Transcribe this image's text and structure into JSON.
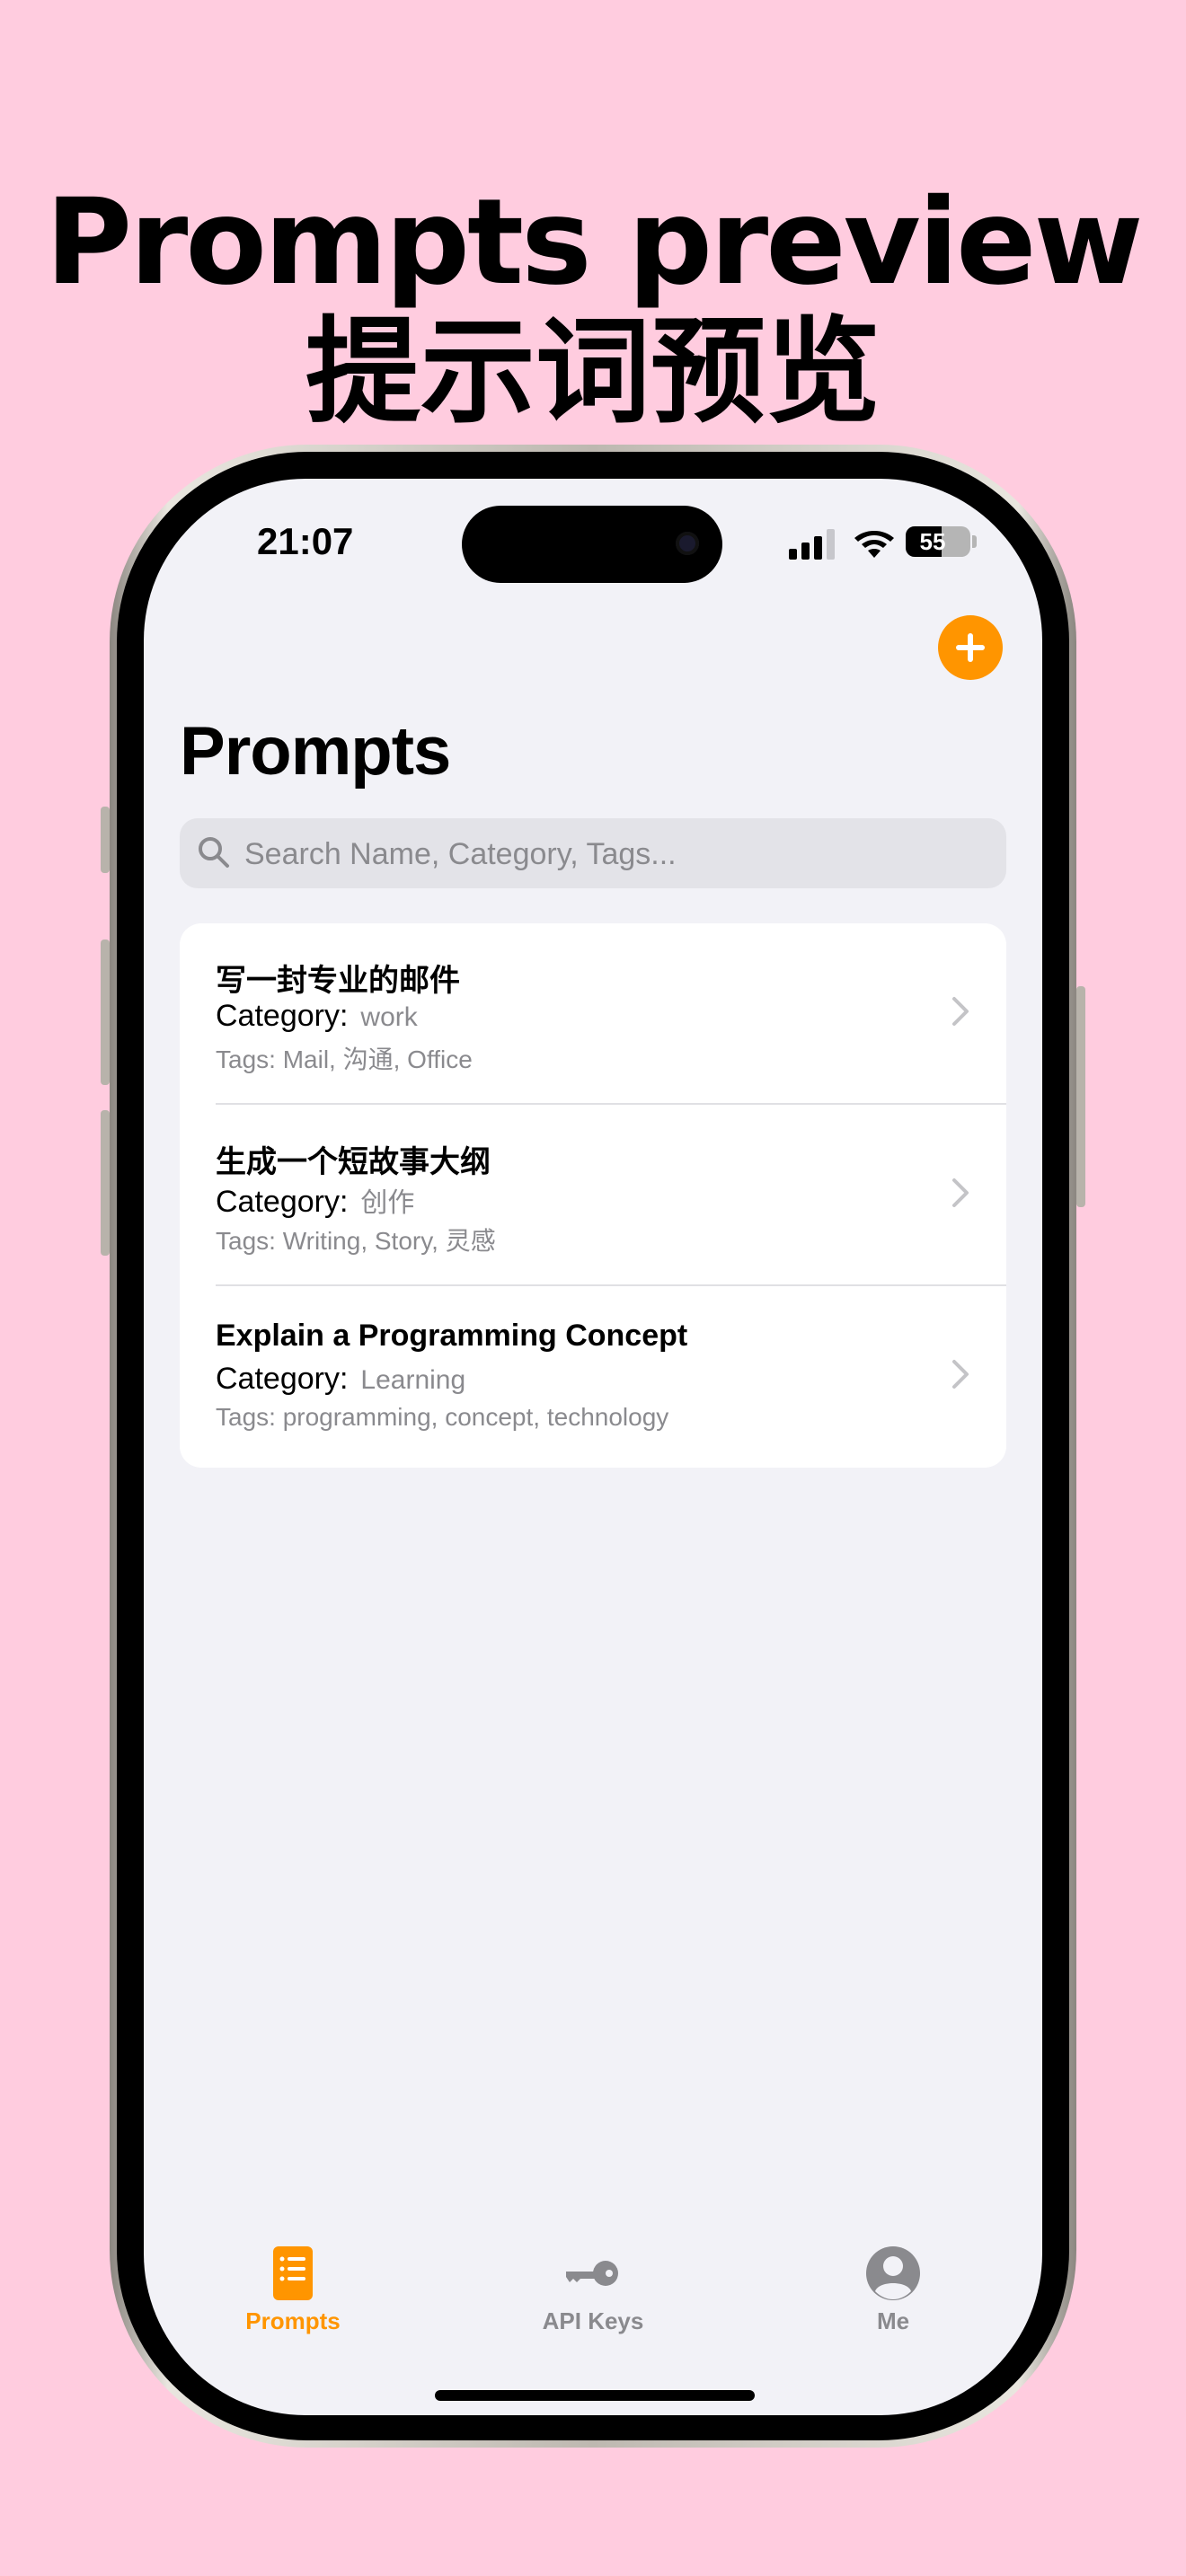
{
  "headline": {
    "title_en": "Prompts preview",
    "title_zh": "提示词预览"
  },
  "status_bar": {
    "time": "21:07",
    "battery_percent": "55",
    "battery_level": 0.55
  },
  "page": {
    "title": "Prompts"
  },
  "search": {
    "placeholder": "Search Name, Category, Tags..."
  },
  "category_label": "Category:",
  "prompts": [
    {
      "title": "写一封专业的邮件",
      "category": "work",
      "tags": "Tags: Mail, 沟通, Office"
    },
    {
      "title": "生成一个短故事大纲",
      "category": "创作",
      "tags": "Tags: Writing, Story, 灵感"
    },
    {
      "title": "Explain a Programming Concept",
      "category": "Learning",
      "tags": "Tags: programming, concept, technology"
    }
  ],
  "tabs": [
    {
      "label": "Prompts",
      "icon": "list-doc-icon",
      "active": true
    },
    {
      "label": "API Keys",
      "icon": "key-icon",
      "active": false
    },
    {
      "label": "Me",
      "icon": "person-circle-icon",
      "active": false
    }
  ],
  "colors": {
    "accent": "#FF9500",
    "background": "#FFCCDF",
    "tab_inactive": "#8A8A8E",
    "screen_bg": "#F2F2F7"
  }
}
